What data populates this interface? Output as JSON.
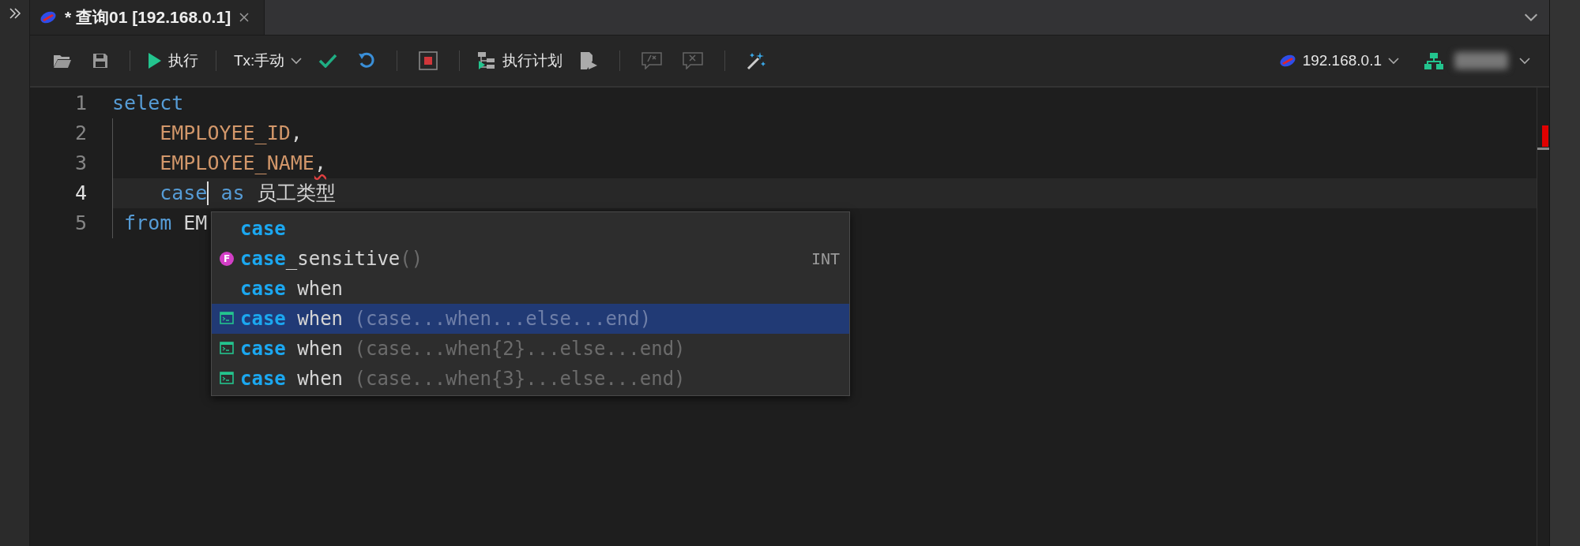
{
  "tab": {
    "title": "* 查询01 [192.168.0.1]",
    "selected": true
  },
  "toolbar": {
    "run_label": "执行",
    "tx_mode": "Tx:手动",
    "plan_label": "执行计划",
    "comment_disabled": true,
    "uncomment_disabled": true
  },
  "connection": {
    "host": "192.168.0.1"
  },
  "editor": {
    "lines": [
      {
        "number": "1",
        "current": false,
        "tokens": [
          {
            "kind": "keyword",
            "text": "select"
          }
        ]
      },
      {
        "number": "2",
        "current": false,
        "tokens": [
          {
            "kind": "identifier",
            "text": "    EMPLOYEE_ID"
          },
          {
            "kind": "plain",
            "text": ","
          }
        ]
      },
      {
        "number": "3",
        "current": false,
        "tokens": [
          {
            "kind": "identifier",
            "text": "    EMPLOYEE_NAME"
          },
          {
            "kind": "error",
            "text": ","
          }
        ]
      },
      {
        "number": "4",
        "current": true,
        "tokens": [
          {
            "kind": "keyword",
            "text": "    case"
          },
          {
            "kind": "caret"
          },
          {
            "kind": "keyword",
            "text": " as"
          },
          {
            "kind": "plain",
            "text": " 员工类型"
          }
        ]
      },
      {
        "number": "5",
        "current": false,
        "tokens": [
          {
            "kind": "keyword",
            "text": " from"
          },
          {
            "kind": "plain",
            "text": " EM"
          }
        ]
      }
    ]
  },
  "completion": {
    "items": [
      {
        "kind": "keyword",
        "match": "case",
        "selected": false
      },
      {
        "kind": "function",
        "badge": "F",
        "match": "case",
        "rest": "_sensitive",
        "hint": "()",
        "type": "INT",
        "selected": false
      },
      {
        "kind": "keyword",
        "match": "case",
        "rest": " when",
        "selected": false
      },
      {
        "kind": "snippet",
        "match": "case",
        "rest": " when",
        "hint": " (case...when...else...end)",
        "selected": true
      },
      {
        "kind": "snippet",
        "match": "case",
        "rest": " when",
        "hint": " (case...when{2}...else...end)",
        "selected": false
      },
      {
        "kind": "snippet",
        "match": "case",
        "rest": " when",
        "hint": " (case...when{3}...else...end)",
        "selected": false
      }
    ]
  }
}
